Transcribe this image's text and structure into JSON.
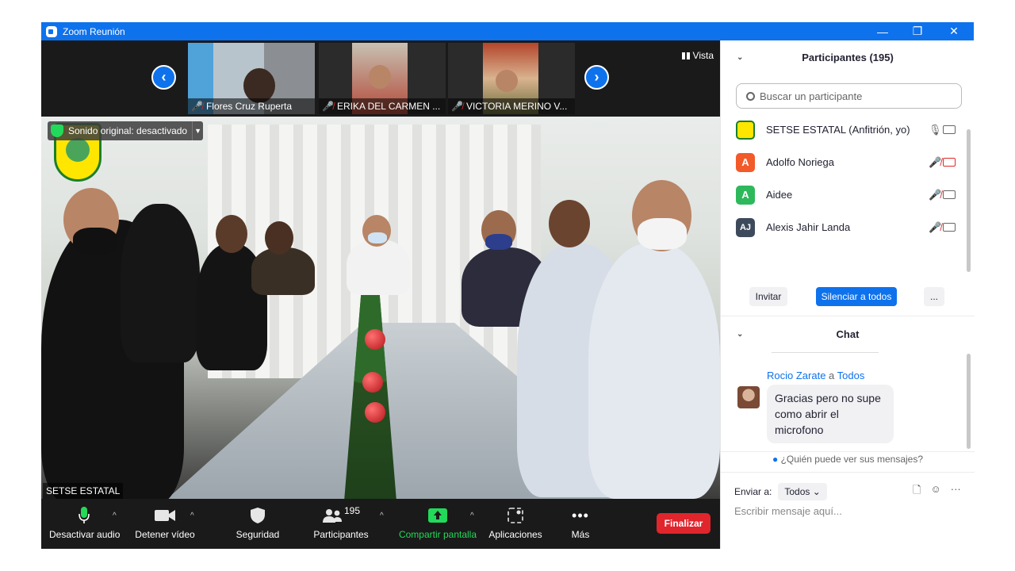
{
  "window": {
    "title": "Zoom Reunión",
    "controls": [
      "—",
      "❐",
      "✕"
    ]
  },
  "gallery": {
    "thumbnails": [
      {
        "name": "Flores Cruz Ruperta"
      },
      {
        "name": "ERIKA DEL CARMEN ..."
      },
      {
        "name": "VICTORIA MERINO V..."
      }
    ],
    "view_label": "Vista"
  },
  "main_video": {
    "sound_label": "Sonido original: desactivado",
    "speaker_name": "SETSE ESTATAL"
  },
  "toolbar": {
    "audio": "Desactivar audio",
    "video": "Detener vídeo",
    "security": "Seguridad",
    "participants": "Participantes",
    "participants_count": "195",
    "share": "Compartir pantalla",
    "apps": "Aplicaciones",
    "more": "Más",
    "end": "Finalizar"
  },
  "participants_panel": {
    "title": "Participantes (195)",
    "search_placeholder": "Buscar un participante",
    "list": [
      {
        "name": "SETSE ESTATAL (Anfitrión, yo)",
        "initials": "",
        "color": "#ffe600"
      },
      {
        "name": "Adolfo Noriega",
        "initials": "A",
        "color": "#f25a29"
      },
      {
        "name": "Aidee",
        "initials": "A",
        "color": "#2eb85c"
      },
      {
        "name": "Alexis Jahir Landa",
        "initials": "AJ",
        "color": "#3d4a5c"
      }
    ],
    "invite": "Invitar",
    "mute_all": "Silenciar a todos",
    "more": "..."
  },
  "chat": {
    "title": "Chat",
    "sender": "Rocio Zarate",
    "to_word": "a",
    "recipient": "Todos",
    "message": "Gracias pero no supe como abrir el microfono",
    "who_sees": "¿Quién puede ver sus mensajes?",
    "send_to_label": "Enviar a:",
    "send_to_value": "Todos",
    "input_placeholder": "Escribir mensaje aquí..."
  },
  "colors": {
    "zoom_blue": "#0e72ed",
    "end_red": "#e0252c",
    "share_green": "#23d959",
    "muted_red": "#e02828"
  }
}
